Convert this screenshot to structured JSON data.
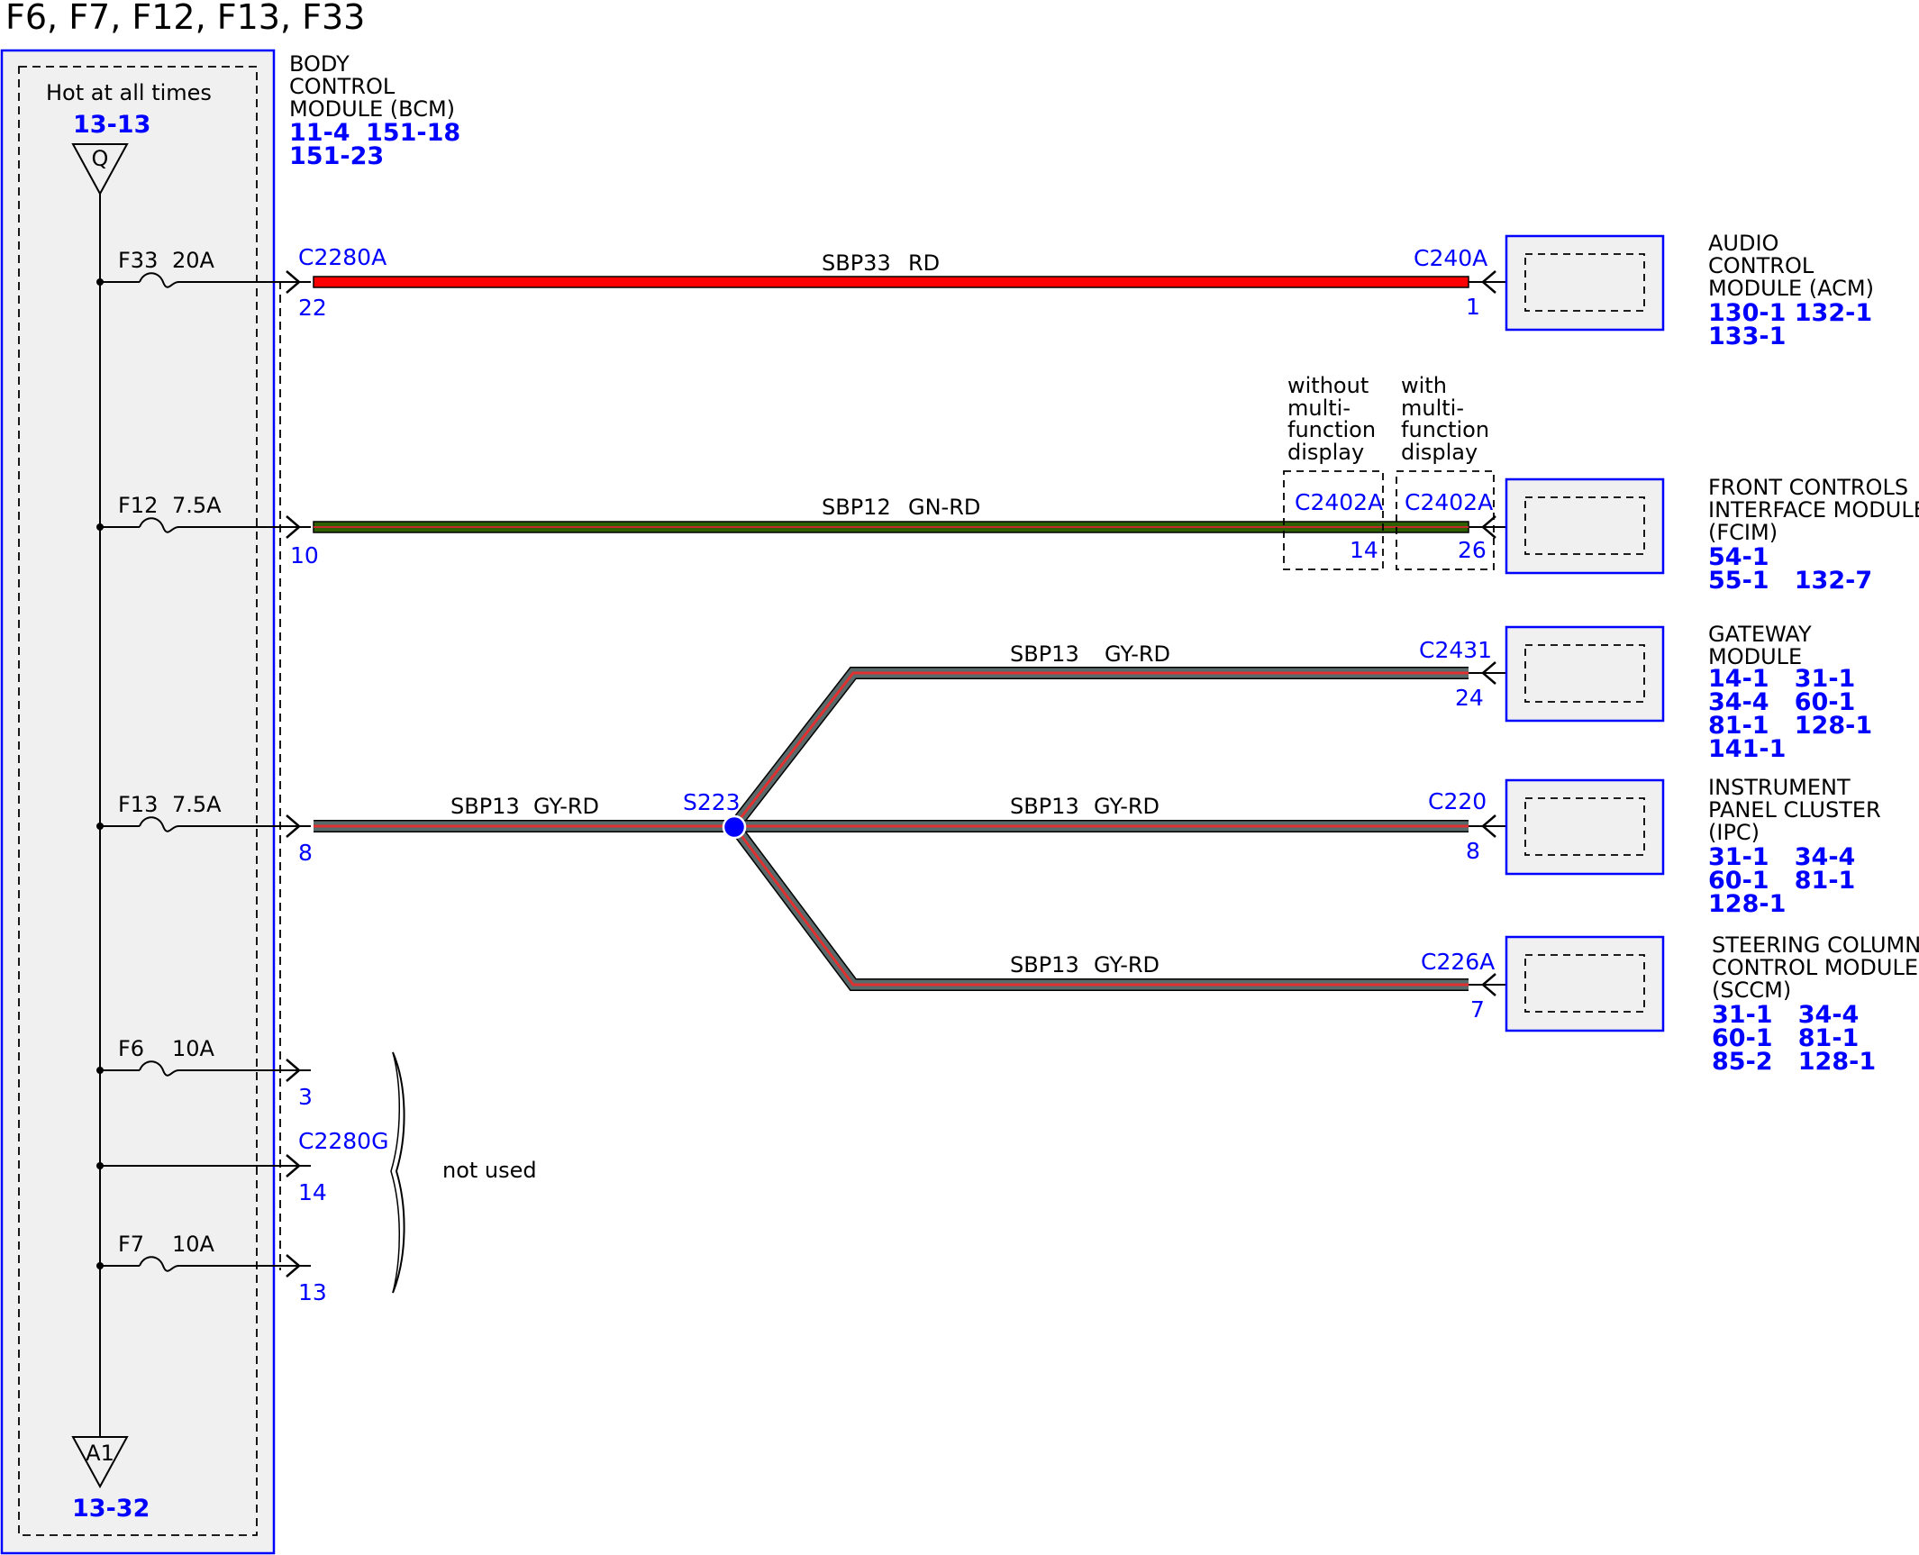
{
  "title": "F6, F7, F12, F13, F33",
  "colors": {
    "module_border": "#0000ff",
    "ref_text": "#0000ff",
    "box_fill": "#f0f0f0",
    "wire_red": "#ff0000",
    "wire_green": "#2e5f00",
    "wire_gray": "#5a6a6a",
    "wire_stripe": "#e03030"
  },
  "bcm": {
    "hot_label": "Hot at all times",
    "hot_ref": "13-13",
    "top_symbol": "Q",
    "bottom_symbol": "A1",
    "bottom_ref": "13-32",
    "name_lines": [
      "BODY",
      "CONTROL",
      "MODULE (BCM)"
    ],
    "refs": [
      "11-4",
      "151-18",
      "151-23"
    ]
  },
  "fuses": [
    {
      "name": "F33",
      "rating": "20A"
    },
    {
      "name": "F12",
      "rating": "7.5A"
    },
    {
      "name": "F13",
      "rating": "7.5A"
    },
    {
      "name": "F6",
      "rating": "10A"
    },
    {
      "name": "F7",
      "rating": "10A"
    }
  ],
  "bcm_connectors": {
    "main": "C2280A",
    "secondary": "C2280G",
    "pins": [
      "22",
      "10",
      "8",
      "3",
      "14",
      "13"
    ]
  },
  "circuits": [
    {
      "label": "SBP33",
      "color_code": "RD"
    },
    {
      "label": "SBP12",
      "color_code": "GN-RD"
    },
    {
      "label": "SBP13",
      "color_code": "GY-RD"
    }
  ],
  "splice": {
    "name": "S223"
  },
  "fcim_options": {
    "without_lines": [
      "without",
      "multi-",
      "function",
      "display"
    ],
    "with_lines": [
      "with",
      "multi-",
      "function",
      "display"
    ],
    "without_connector": "C2402A",
    "without_pin": "14",
    "with_connector": "C2402A",
    "with_pin": "26"
  },
  "not_used": "not used",
  "modules": [
    {
      "connector": "C240A",
      "pin": "1",
      "name_lines": [
        "AUDIO",
        "CONTROL",
        "MODULE (ACM)"
      ],
      "refs": [
        "130-1 132-1",
        "133-1"
      ]
    },
    {
      "connector": "",
      "pin": "",
      "name_lines": [
        "FRONT CONTROLS",
        "INTERFACE MODULE",
        "(FCIM)"
      ],
      "refs": [
        "54-1",
        "55-1   132-7"
      ]
    },
    {
      "connector": "C2431",
      "pin": "24",
      "name_lines": [
        "GATEWAY",
        "MODULE"
      ],
      "refs": [
        "14-1   31-1",
        "34-4   60-1",
        "81-1   128-1",
        "141-1"
      ]
    },
    {
      "connector": "C220",
      "pin": "8",
      "name_lines": [
        "INSTRUMENT",
        "PANEL CLUSTER",
        "(IPC)"
      ],
      "refs": [
        "31-1   34-4",
        "60-1   81-1",
        "128-1"
      ]
    },
    {
      "connector": "C226A",
      "pin": "7",
      "name_lines": [
        "STEERING COLUMN",
        "CONTROL MODULE",
        "(SCCM)"
      ],
      "refs": [
        "31-1   34-4",
        "60-1   81-1",
        "85-2   128-1"
      ]
    }
  ]
}
